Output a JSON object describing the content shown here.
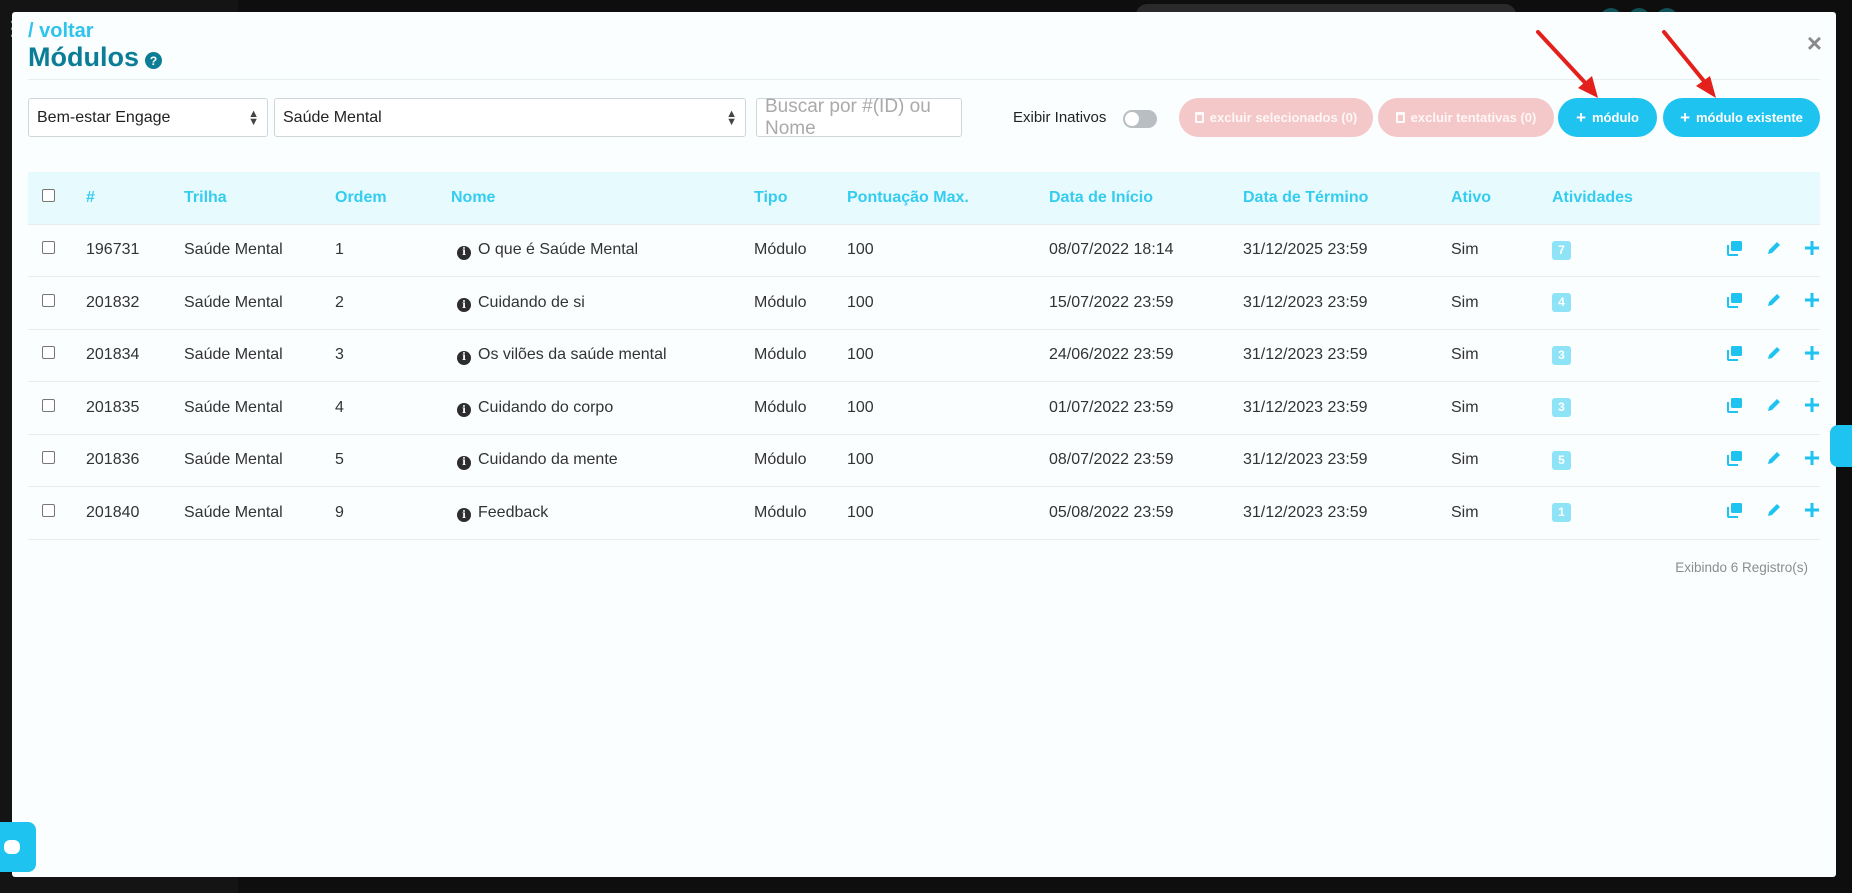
{
  "header": {
    "back_label": "/ voltar",
    "title": "Módulos",
    "help_icon": "?",
    "close_icon": "×"
  },
  "filters": {
    "program_select": "Bem-estar Engage",
    "trail_select": "Saúde Mental",
    "search_placeholder": "Buscar por #(ID) ou Nome",
    "inactive_label": "Exibir Inativos",
    "inactive_toggle_on": false
  },
  "buttons": {
    "delete_selected": "excluir selecionados (0)",
    "delete_attempts": "excluir tentativas (0)",
    "add_module": "módulo",
    "add_existing_module": "módulo existente"
  },
  "table": {
    "headers": [
      "#",
      "Trilha",
      "Ordem",
      "Nome",
      "Tipo",
      "Pontuação Max.",
      "Data de Início",
      "Data de Término",
      "Ativo",
      "Atividades"
    ],
    "rows": [
      {
        "id": "196731",
        "trilha": "Saúde Mental",
        "ordem": "1",
        "nome": "O que é Saúde Mental",
        "tipo": "Módulo",
        "pontuacao": "100",
        "inicio": "08/07/2022 18:14",
        "termino": "31/12/2025 23:59",
        "ativo": "Sim",
        "atividades": "7"
      },
      {
        "id": "201832",
        "trilha": "Saúde Mental",
        "ordem": "2",
        "nome": "Cuidando de si",
        "tipo": "Módulo",
        "pontuacao": "100",
        "inicio": "15/07/2022 23:59",
        "termino": "31/12/2023 23:59",
        "ativo": "Sim",
        "atividades": "4"
      },
      {
        "id": "201834",
        "trilha": "Saúde Mental",
        "ordem": "3",
        "nome": "Os vilões da saúde mental",
        "tipo": "Módulo",
        "pontuacao": "100",
        "inicio": "24/06/2022 23:59",
        "termino": "31/12/2023 23:59",
        "ativo": "Sim",
        "atividades": "3"
      },
      {
        "id": "201835",
        "trilha": "Saúde Mental",
        "ordem": "4",
        "nome": "Cuidando do corpo",
        "tipo": "Módulo",
        "pontuacao": "100",
        "inicio": "01/07/2022 23:59",
        "termino": "31/12/2023 23:59",
        "ativo": "Sim",
        "atividades": "3"
      },
      {
        "id": "201836",
        "trilha": "Saúde Mental",
        "ordem": "5",
        "nome": "Cuidando da mente",
        "tipo": "Módulo",
        "pontuacao": "100",
        "inicio": "08/07/2022 23:59",
        "termino": "31/12/2023 23:59",
        "ativo": "Sim",
        "atividades": "5"
      },
      {
        "id": "201840",
        "trilha": "Saúde Mental",
        "ordem": "9",
        "nome": "Feedback",
        "tipo": "Módulo",
        "pontuacao": "100",
        "inicio": "05/08/2022 23:59",
        "termino": "31/12/2023 23:59",
        "ativo": "Sim",
        "atividades": "1"
      }
    ]
  },
  "footer": {
    "count_text": "Exibindo 6 Registro(s)"
  },
  "icons": {
    "row_actions": [
      "copy-icon",
      "pencil-icon",
      "plus-icon"
    ],
    "annotation": "red-arrow"
  },
  "colors": {
    "accent": "#1ec3f0",
    "title": "#0c7d96",
    "header_text": "#34ccef",
    "danger_disabled": "#f4c8c8",
    "annotation_arrow": "#e3201b"
  }
}
